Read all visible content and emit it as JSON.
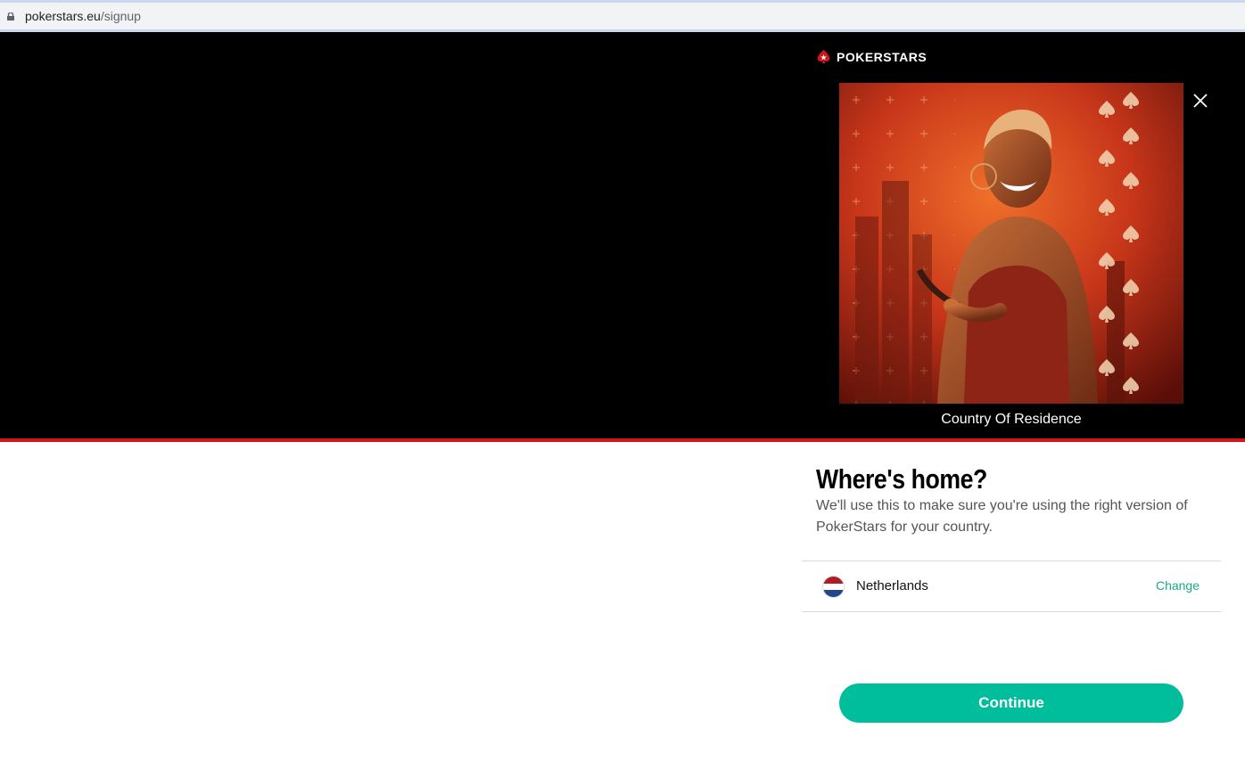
{
  "browser": {
    "url_domain": "pokerstars.eu",
    "url_path": "/signup"
  },
  "brand": {
    "name": "POKERSTARS",
    "accent": "#d1171c"
  },
  "hero": {
    "caption": "Country Of Residence"
  },
  "form": {
    "title": "Where's home?",
    "description": "We'll use this to make sure you're using the right version of PokerStars for your country.",
    "country": "Netherlands",
    "change_label": "Change",
    "continue_label": "Continue"
  },
  "colors": {
    "primary_button": "#00bd9c",
    "link": "#1aa88a"
  },
  "icons": [
    "lock-icon",
    "pokerstars-logo-icon",
    "close-icon",
    "netherlands-flag-icon"
  ]
}
